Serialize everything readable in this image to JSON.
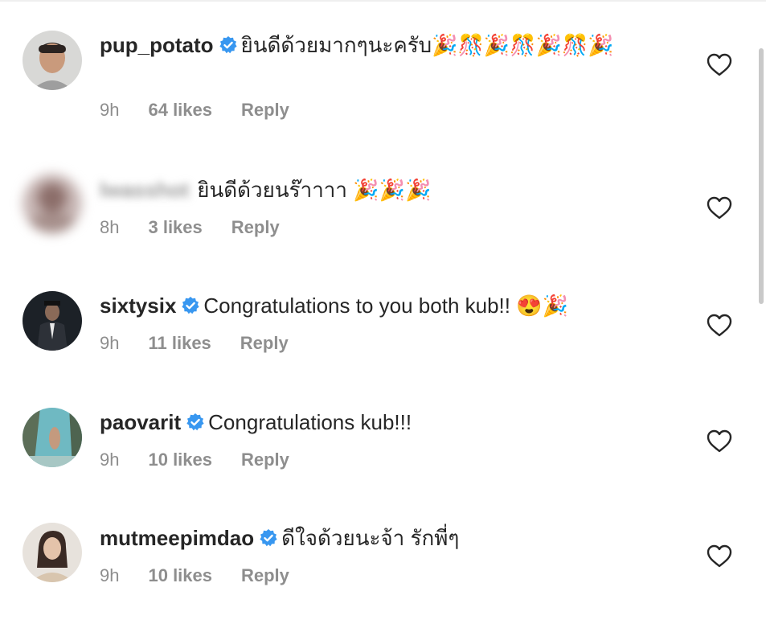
{
  "comments": [
    {
      "username": "pup_potato",
      "verified": true,
      "text": "ยินดีด้วยมากๆนะครับ",
      "emoji": "🎉🎊🎉🎊🎉🎊🎉",
      "time": "9h",
      "likes": "64 likes",
      "reply": "Reply"
    },
    {
      "username": "lwasshot",
      "verified": false,
      "text": "ยินดีด้วยนร๊าาาา",
      "emoji": "🎉🎉🎉",
      "time": "8h",
      "likes": "3 likes",
      "reply": "Reply"
    },
    {
      "username": "sixtysix",
      "verified": true,
      "text": "Congratulations to you both kub!!",
      "emoji": "😍🎉",
      "time": "9h",
      "likes": "11 likes",
      "reply": "Reply"
    },
    {
      "username": "paovarit",
      "verified": true,
      "text": "Congratulations kub!!!",
      "emoji": "",
      "time": "9h",
      "likes": "10 likes",
      "reply": "Reply"
    },
    {
      "username": "mutmeepimdao",
      "verified": true,
      "text": "ดีใจด้วยนะจ้า รักพี่ๆ",
      "emoji": "",
      "time": "9h",
      "likes": "10 likes",
      "reply": "Reply"
    }
  ],
  "colors": {
    "verified_badge": "#3897f0",
    "meta_text": "#8e8e8e",
    "primary_text": "#262626"
  },
  "icons": {
    "like": "heart-outline-icon",
    "verified": "verified-badge-icon"
  }
}
